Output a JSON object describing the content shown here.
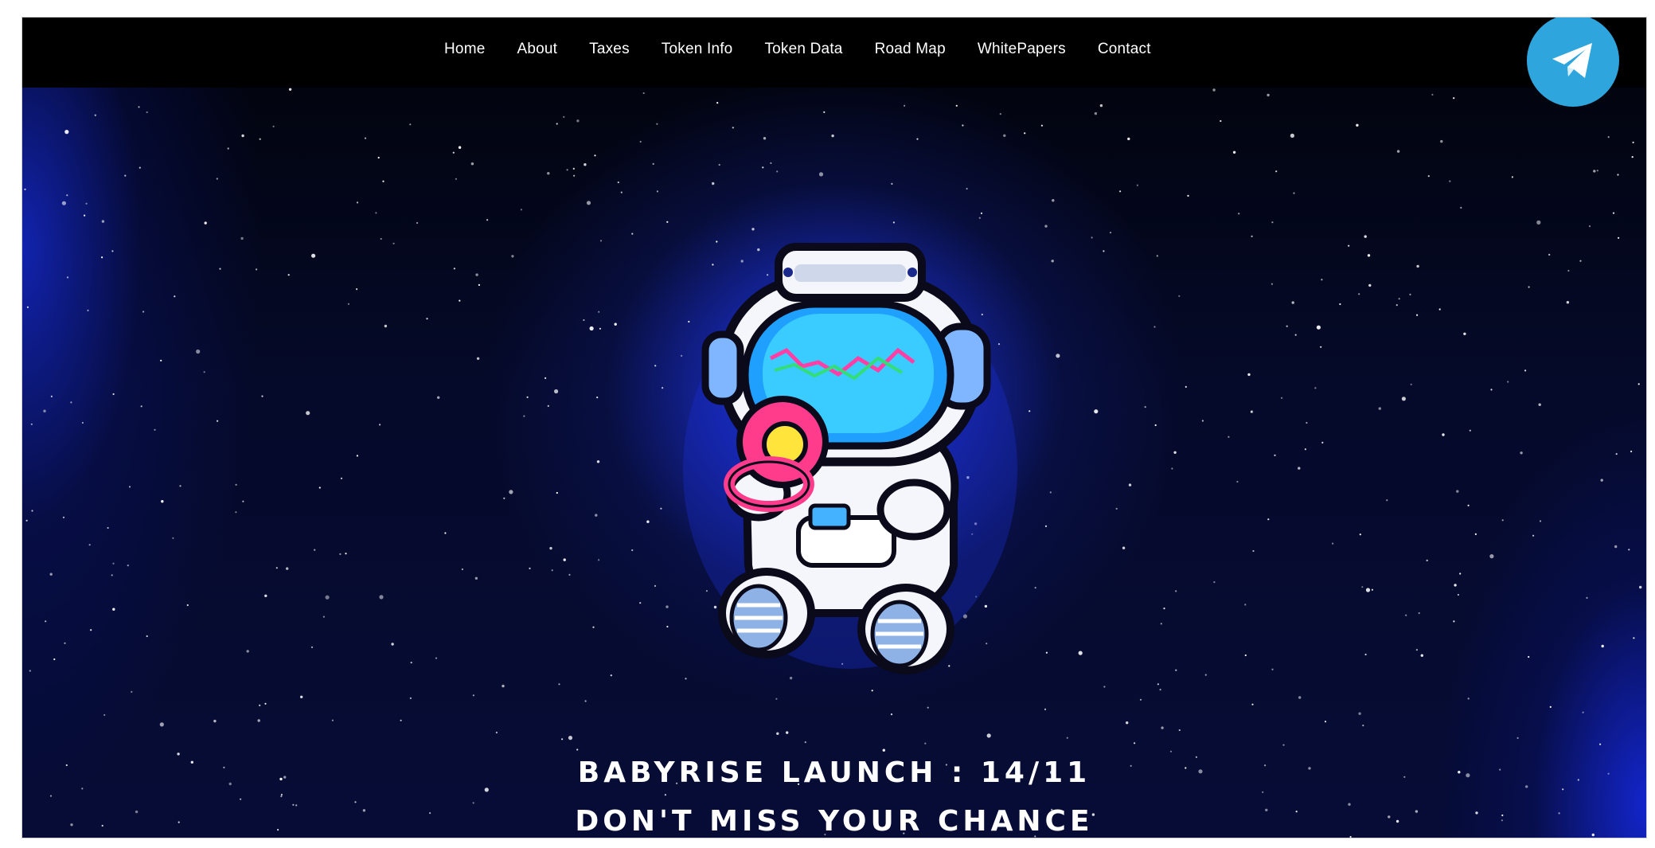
{
  "nav": {
    "items": [
      {
        "label": "Home"
      },
      {
        "label": "About"
      },
      {
        "label": "Taxes"
      },
      {
        "label": "Token Info"
      },
      {
        "label": "Token Data"
      },
      {
        "label": "Road Map"
      },
      {
        "label": "WhitePapers"
      },
      {
        "label": "Contact"
      }
    ]
  },
  "social": {
    "telegram_icon": "telegram-paper-plane-icon",
    "telegram_color": "#2ea6dd"
  },
  "hero": {
    "headline_1": "BABYRISE LAUNCH : 14/11",
    "headline_2": "DON'T MISS YOUR CHANCE",
    "mascot": "baby-astronaut-with-pacifier",
    "accent_color": "#1c37d6"
  }
}
